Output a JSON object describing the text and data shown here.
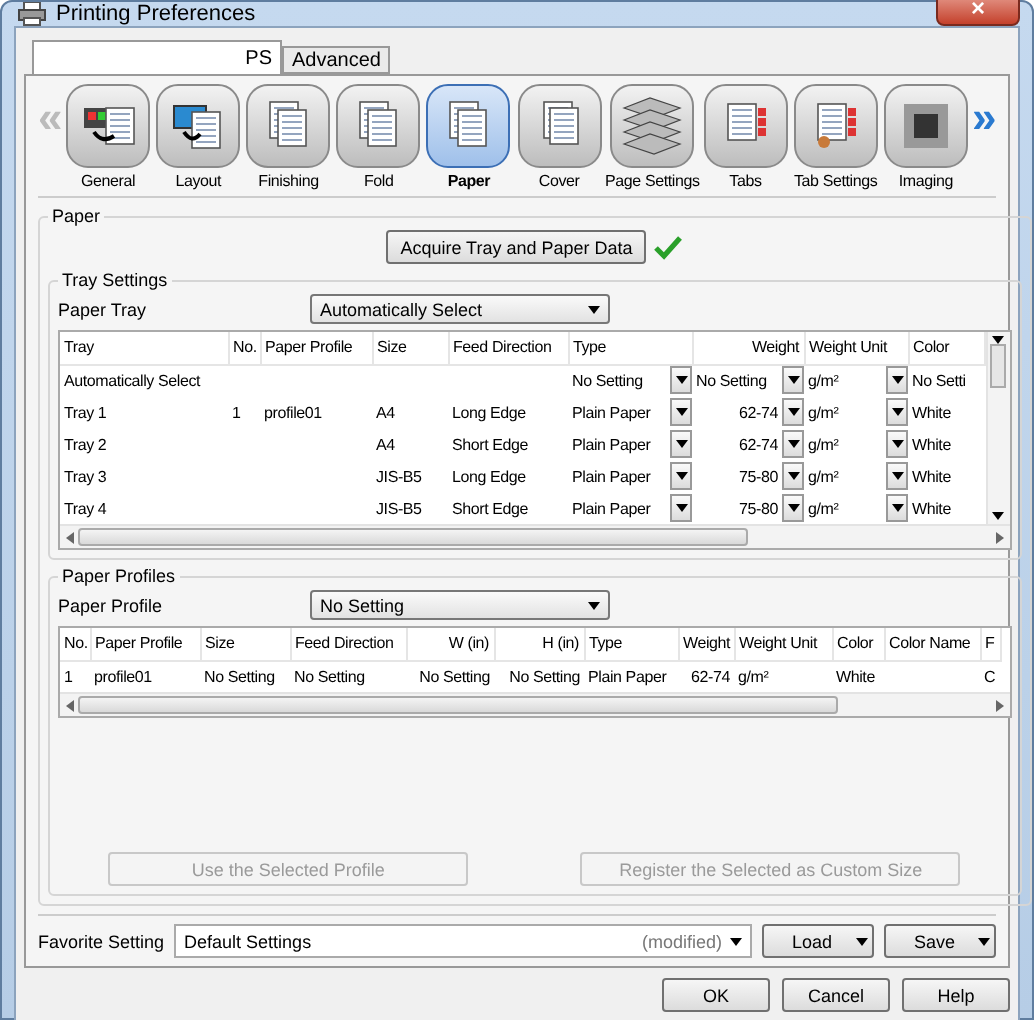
{
  "window": {
    "title": "Printing Preferences",
    "close": "×"
  },
  "tabs": [
    {
      "label": "PS",
      "selected": true
    },
    {
      "label": "Advanced",
      "selected": false
    }
  ],
  "nav": {
    "prev": "«",
    "next": "»",
    "items": [
      {
        "label": "General",
        "selected": false
      },
      {
        "label": "Layout",
        "selected": false
      },
      {
        "label": "Finishing",
        "selected": false
      },
      {
        "label": "Fold",
        "selected": false
      },
      {
        "label": "Paper",
        "selected": true
      },
      {
        "label": "Cover",
        "selected": false
      },
      {
        "label": "Page Settings",
        "selected": false
      },
      {
        "label": "Tabs",
        "selected": false
      },
      {
        "label": "Tab Settings",
        "selected": false
      },
      {
        "label": "Imaging",
        "selected": false
      }
    ]
  },
  "paper": {
    "title": "Paper",
    "acquire_button": "Acquire Tray and Paper Data",
    "tray_settings": {
      "title": "Tray Settings",
      "label": "Paper Tray",
      "value": "Automatically Select",
      "columns": [
        {
          "label": "Tray",
          "kind": "text"
        },
        {
          "label": "No.",
          "kind": "text"
        },
        {
          "label": "Paper Profile",
          "kind": "text"
        },
        {
          "label": "Size",
          "kind": "text"
        },
        {
          "label": "Feed Direction",
          "kind": "text"
        },
        {
          "label": "Type",
          "kind": "dropdown"
        },
        {
          "label": "Weight",
          "kind": "number-dropdown"
        },
        {
          "label": "Weight Unit",
          "kind": "dropdown"
        },
        {
          "label": "Color",
          "kind": "text"
        }
      ],
      "rows": [
        [
          "Automatically Select",
          null,
          null,
          null,
          null,
          "No Setting",
          "No Setting",
          "g/m²",
          "No Setti"
        ],
        [
          "Tray 1",
          "1",
          "profile01",
          "A4",
          "Long Edge",
          "Plain Paper",
          "62-74",
          "g/m²",
          "White"
        ],
        [
          "Tray 2",
          null,
          null,
          "A4",
          "Short Edge",
          "Plain Paper",
          "62-74",
          "g/m²",
          "White"
        ],
        [
          "Tray 3",
          null,
          null,
          "JIS-B5",
          "Long Edge",
          "Plain Paper",
          "75-80",
          "g/m²",
          "White"
        ],
        [
          "Tray 4",
          null,
          null,
          "JIS-B5",
          "Short Edge",
          "Plain Paper",
          "75-80",
          "g/m²",
          "White"
        ]
      ]
    },
    "profiles": {
      "title": "Paper Profiles",
      "label": "Paper Profile",
      "value": "No Setting",
      "columns": [
        {
          "label": "No.",
          "kind": "text"
        },
        {
          "label": "Paper Profile",
          "kind": "text"
        },
        {
          "label": "Size",
          "kind": "text"
        },
        {
          "label": "Feed Direction",
          "kind": "text"
        },
        {
          "label": "W (in)",
          "kind": "number"
        },
        {
          "label": "H (in)",
          "kind": "number"
        },
        {
          "label": "Type",
          "kind": "text"
        },
        {
          "label": "Weight",
          "kind": "number"
        },
        {
          "label": "Weight Unit",
          "kind": "text"
        },
        {
          "label": "Color",
          "kind": "text"
        },
        {
          "label": "Color Name",
          "kind": "text"
        },
        {
          "label": "F",
          "kind": "text"
        }
      ],
      "rows": [
        [
          "1",
          "profile01",
          "No Setting",
          "No Setting",
          "No Setting",
          "No Setting",
          "Plain Paper",
          "62-74",
          "g/m²",
          "White",
          null,
          "C"
        ]
      ],
      "buttons": [
        {
          "label": "Use the Selected Profile",
          "disabled": true
        },
        {
          "label": "Register the Selected as Custom Size",
          "disabled": true
        }
      ]
    }
  },
  "favorite": {
    "label": "Favorite Setting",
    "value": "Default Settings",
    "note": "(modified)",
    "load": "Load",
    "save": "Save"
  },
  "buttons": [
    "OK",
    "Cancel",
    "Help"
  ]
}
